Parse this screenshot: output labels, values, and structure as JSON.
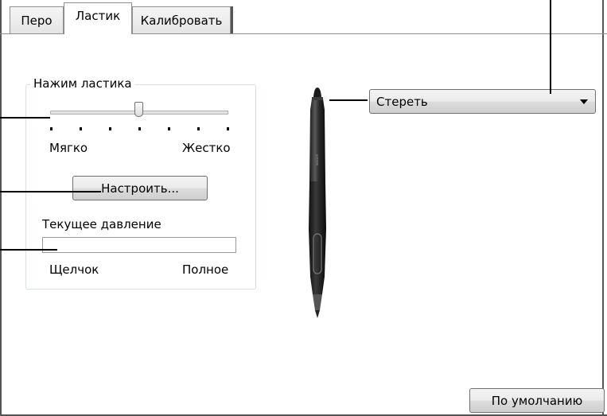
{
  "tabs": [
    {
      "label": "Перо",
      "active": false
    },
    {
      "label": "Ластик",
      "active": true
    },
    {
      "label": "Калибровать",
      "active": false
    }
  ],
  "eraser_feel": {
    "group_title": "Нажим ластика",
    "slider_position_fraction": 0.5,
    "tick_count": 7,
    "soft_label": "Мягко",
    "firm_label": "Жестко",
    "customize_button": "Настроить..."
  },
  "current_pressure": {
    "label": "Текущее давление",
    "level_fraction": 0.0,
    "click_label": "Щелчок",
    "max_label": "Полное"
  },
  "eraser_function": {
    "selected": "Стереть"
  },
  "default_button": "По умолчанию"
}
